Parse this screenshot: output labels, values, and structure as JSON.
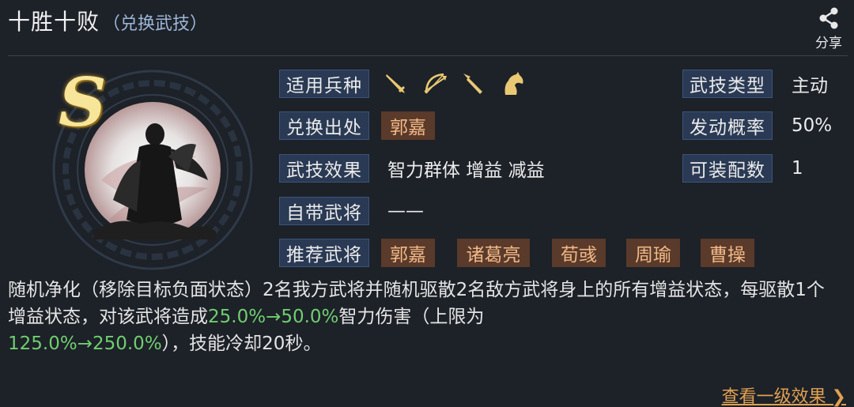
{
  "header": {
    "title": "十胜十败",
    "subtitle": "（兑换武技）",
    "share_label": "分享"
  },
  "skill": {
    "grade": "S",
    "rows": {
      "unit_types": {
        "label": "适用兵种",
        "icons": [
          "sword-icon",
          "bow-icon",
          "spear-icon",
          "horse-icon"
        ]
      },
      "source": {
        "label": "兑换出处",
        "tag": "郭嘉"
      },
      "effect": {
        "label": "武技效果",
        "value": "智力群体 增益 减益"
      },
      "own_general": {
        "label": "自带武将",
        "value": "——"
      },
      "recommended": {
        "label": "推荐武将",
        "tags": [
          "郭嘉",
          "诸葛亮",
          "荀彧",
          "周瑜",
          "曹操"
        ]
      },
      "skill_type": {
        "label": "武技类型",
        "value": "主动"
      },
      "trigger_rate": {
        "label": "发动概率",
        "value": "50%"
      },
      "equip_count": {
        "label": "可装配数",
        "value": "1"
      }
    }
  },
  "description": {
    "part1": "随机净化（移除目标负面状态）2名我方武将并随机驱散2名敌方武将身上的所有增益状态，每驱散1个增益状态，对该武将造成",
    "highlight1": "25.0%→50.0%",
    "part2": "智力伤害（上限为",
    "highlight2": "125.0%→250.0%",
    "part3": "），技能冷却20秒。"
  },
  "footer": {
    "more_link": "查看一级效果 ❯"
  },
  "colors": {
    "background": "#1d2128",
    "label_bg": "#2a3a54",
    "tag_bg": "#5a3a2a",
    "tag_text": "#f0b886",
    "highlight": "#6fcf6f",
    "link": "#e0a050",
    "icon_gold": "#e8c872"
  }
}
